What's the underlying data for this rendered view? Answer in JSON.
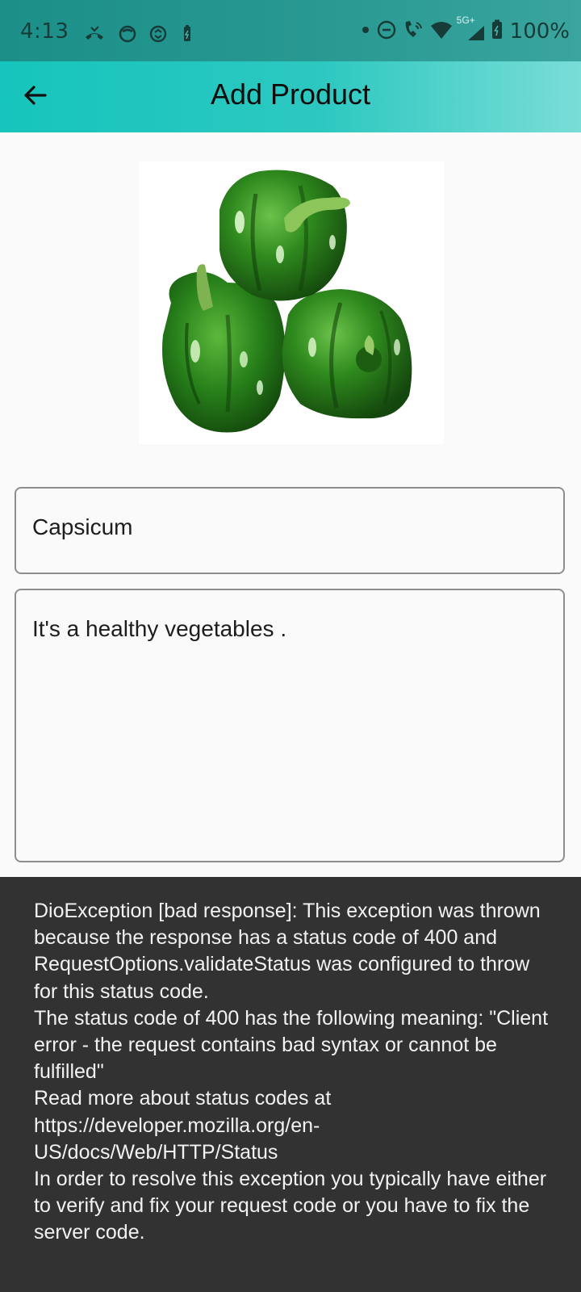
{
  "status_bar": {
    "time": "4:13",
    "network_label": "5G+",
    "battery_percent": "100%",
    "icons": [
      "missed-call-icon",
      "chat-bubble-icon",
      "sync-app-icon",
      "battery-saver-icon",
      "dot-icon",
      "do-not-disturb-icon",
      "wifi-calling-icon",
      "wifi-icon",
      "signal-icon",
      "battery-icon"
    ]
  },
  "app_bar": {
    "title": "Add Product",
    "back_icon": "arrow-back-icon"
  },
  "product": {
    "image": "green-capsicum-photo",
    "name_value": "Capsicum",
    "description_value": "It's a healthy vegetables ."
  },
  "snackbar": {
    "message": "DioException [bad response]: This exception was thrown because the response has a status code of 400 and RequestOptions.validateStatus was configured to throw for this status code.\nThe status code of 400 has the following meaning: \"Client error - the request contains bad syntax or cannot be fulfilled\"\nRead more about status codes at https://developer.mozilla.org/en-US/docs/Web/HTTP/Status\nIn order to resolve this exception you typically have either to verify and fix your request code or you have to fix the server code."
  },
  "colors": {
    "status_bar": "#1b8f88",
    "app_bar_start": "#16c5bd",
    "app_bar_end": "#7addd7",
    "snackbar_bg": "#323232",
    "capsicum_green": "#2f8a1e"
  }
}
